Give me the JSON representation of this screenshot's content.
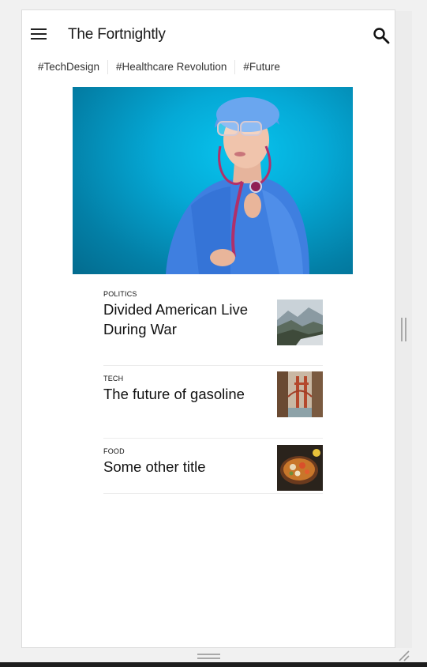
{
  "app": {
    "title": "The Fortnightly",
    "menu_icon": "menu-icon",
    "search_icon": "search-icon"
  },
  "tags": [
    "#TechDesign",
    "#Healthcare Revolution",
    "#Future"
  ],
  "hero": {
    "image": "doctor-with-stethoscope-photo"
  },
  "articles": [
    {
      "category": "POLITICS",
      "title": "Divided American Live During War",
      "thumbnail": "mountain-landscape-photo"
    },
    {
      "category": "TECH",
      "title": "The future of gasoline",
      "thumbnail": "golden-gate-bridge-photo"
    },
    {
      "category": "FOOD",
      "title": "Some other title",
      "thumbnail": "food-bowl-photo"
    }
  ],
  "colors": {
    "hero_bg": "#05a9d6",
    "text": "#111111",
    "chrome": "#f1f1f1"
  }
}
